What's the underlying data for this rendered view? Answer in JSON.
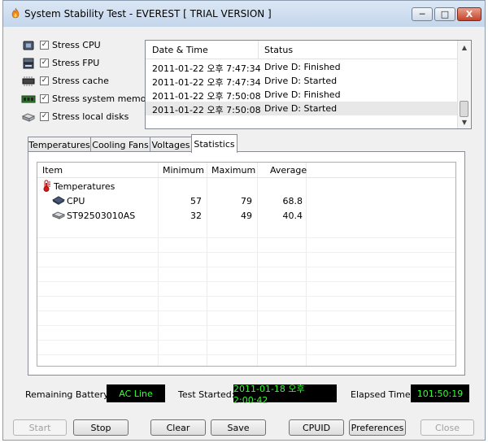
{
  "window": {
    "title": "System Stability Test - EVEREST  [ TRIAL VERSION ]",
    "minimize_glyph": "─",
    "maximize_glyph": "□",
    "close_glyph": "X"
  },
  "stress_options": [
    {
      "label": "Stress CPU",
      "checked": true,
      "icon": "cpu-icon"
    },
    {
      "label": "Stress FPU",
      "checked": true,
      "icon": "fpu-icon"
    },
    {
      "label": "Stress cache",
      "checked": true,
      "icon": "cache-chip-icon"
    },
    {
      "label": "Stress system memory",
      "checked": true,
      "icon": "memory-module-icon"
    },
    {
      "label": "Stress local disks",
      "checked": true,
      "icon": "hard-disk-icon"
    }
  ],
  "check_glyph": "✓",
  "log": {
    "headers": {
      "datetime": "Date & Time",
      "status": "Status"
    },
    "rows": [
      {
        "datetime": "2011-01-22 오후 7:47:34",
        "status": "Drive D: Finished"
      },
      {
        "datetime": "2011-01-22 오후 7:47:34",
        "status": "Drive D: Started"
      },
      {
        "datetime": "2011-01-22 오후 7:50:08",
        "status": "Drive D: Finished"
      },
      {
        "datetime": "2011-01-22 오후 7:50:08",
        "status": "Drive D: Started"
      }
    ],
    "scroll_up_glyph": "▲",
    "scroll_down_glyph": "▼"
  },
  "tabs": {
    "temperatures": "Temperatures",
    "cooling_fans": "Cooling Fans",
    "voltages": "Voltages",
    "statistics": "Statistics"
  },
  "active_tab": "statistics",
  "statistics": {
    "headers": {
      "item": "Item",
      "minimum": "Minimum",
      "maximum": "Maximum",
      "average": "Average"
    },
    "group": "Temperatures",
    "rows": [
      {
        "item": "CPU",
        "minimum": "57",
        "maximum": "79",
        "average": "68.8",
        "icon": "cpu-icon"
      },
      {
        "item": "ST92503010AS",
        "minimum": "32",
        "maximum": "49",
        "average": "40.4",
        "icon": "hard-disk-icon"
      }
    ]
  },
  "status": {
    "battery_label": "Remaining Battery:",
    "battery_value": "AC Line",
    "started_label": "Test Started:",
    "started_value": "2011-01-18 오후 2:00:42",
    "elapsed_label": "Elapsed Time:",
    "elapsed_value": "101:50:19"
  },
  "buttons": {
    "start": "Start",
    "stop": "Stop",
    "clear": "Clear",
    "save": "Save",
    "cpuid": "CPUID",
    "preferences": "Preferences",
    "close": "Close"
  },
  "colors": {
    "status_bg": "#000000",
    "status_text": "#33ff33",
    "disabled_text": "#a0a0a0"
  }
}
